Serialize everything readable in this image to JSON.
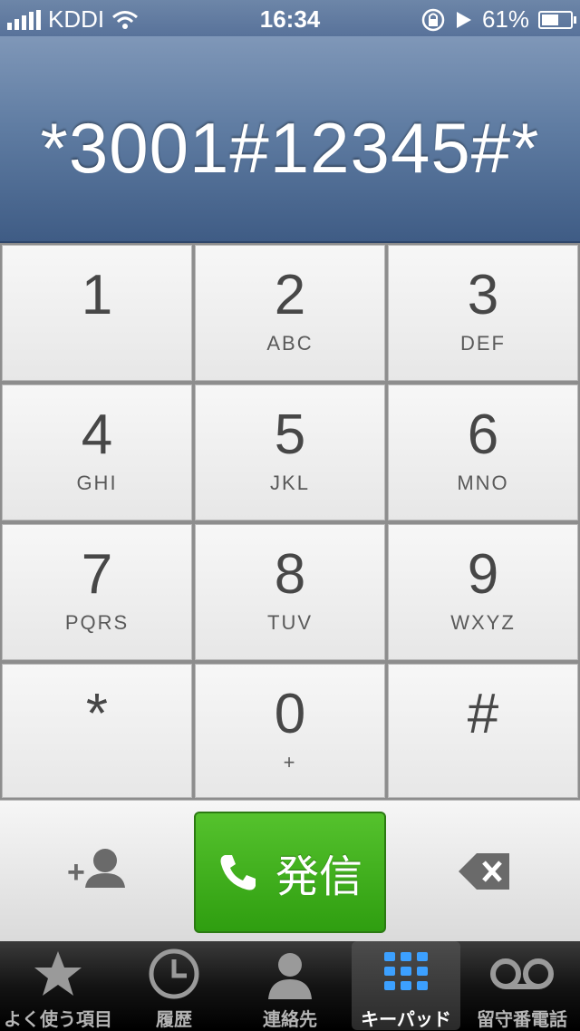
{
  "status_bar": {
    "carrier": "KDDI",
    "time": "16:34",
    "battery": "61%"
  },
  "display": {
    "number": "*3001#12345#*"
  },
  "keypad": {
    "keys": [
      {
        "digit": "1",
        "letters": ""
      },
      {
        "digit": "2",
        "letters": "ABC"
      },
      {
        "digit": "3",
        "letters": "DEF"
      },
      {
        "digit": "4",
        "letters": "GHI"
      },
      {
        "digit": "5",
        "letters": "JKL"
      },
      {
        "digit": "6",
        "letters": "MNO"
      },
      {
        "digit": "7",
        "letters": "PQRS"
      },
      {
        "digit": "8",
        "letters": "TUV"
      },
      {
        "digit": "9",
        "letters": "WXYZ"
      },
      {
        "digit": "*",
        "letters": ""
      },
      {
        "digit": "0",
        "letters": "+"
      },
      {
        "digit": "#",
        "letters": ""
      }
    ]
  },
  "actions": {
    "call_label": "発信"
  },
  "tabs": [
    {
      "label": "よく使う項目",
      "icon": "star-icon"
    },
    {
      "label": "履歴",
      "icon": "clock-icon"
    },
    {
      "label": "連絡先",
      "icon": "contact-icon"
    },
    {
      "label": "キーパッド",
      "icon": "keypad-icon"
    },
    {
      "label": "留守番電話",
      "icon": "voicemail-icon"
    }
  ],
  "colors": {
    "call_green": "#3aa819",
    "display_blue": "#5f7ca2"
  }
}
